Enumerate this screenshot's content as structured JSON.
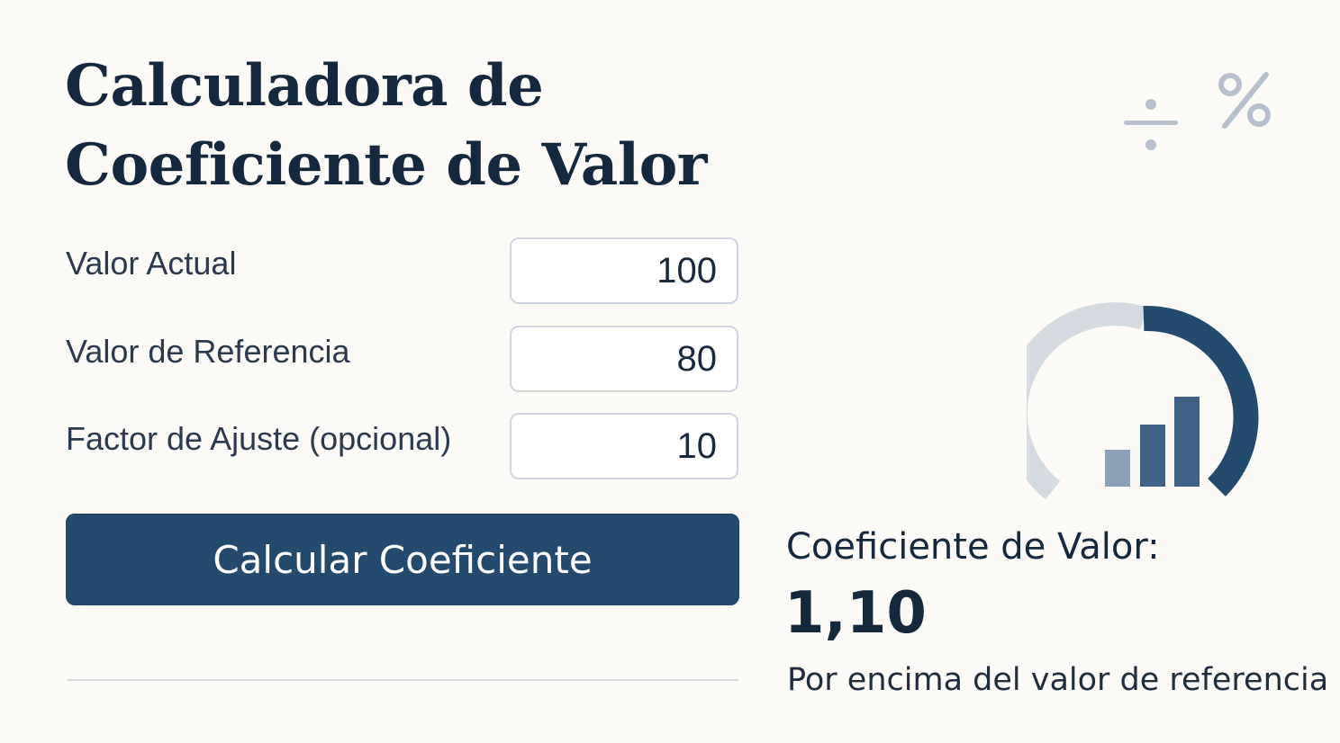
{
  "page": {
    "title_line1": "Calculadora de",
    "title_line2": "Coeficiente de Valor"
  },
  "icons": {
    "divide": "divide-icon",
    "percent": "percent-icon",
    "gauge": "gauge-chart-icon"
  },
  "form": {
    "fields": [
      {
        "label": "Valor Actual",
        "value": "100"
      },
      {
        "label": "Valor de Referencia",
        "value": "80"
      },
      {
        "label": "Factor de Ajuste (opcional)",
        "value": "10"
      }
    ],
    "submit_label": "Calcular Coeficiente"
  },
  "result": {
    "label": "Coeficiente de Valor:",
    "value": "1,10",
    "description": "Por encima del valor de referencia"
  },
  "colors": {
    "primary": "#244a6d",
    "gauge_track": "#d5dae0",
    "bar_light": "#8aa0b8",
    "bar_mid": "#3f6387",
    "bar_dark": "#2e5378",
    "icon_muted": "#b7c0cc",
    "background": "#fbfaf7"
  }
}
